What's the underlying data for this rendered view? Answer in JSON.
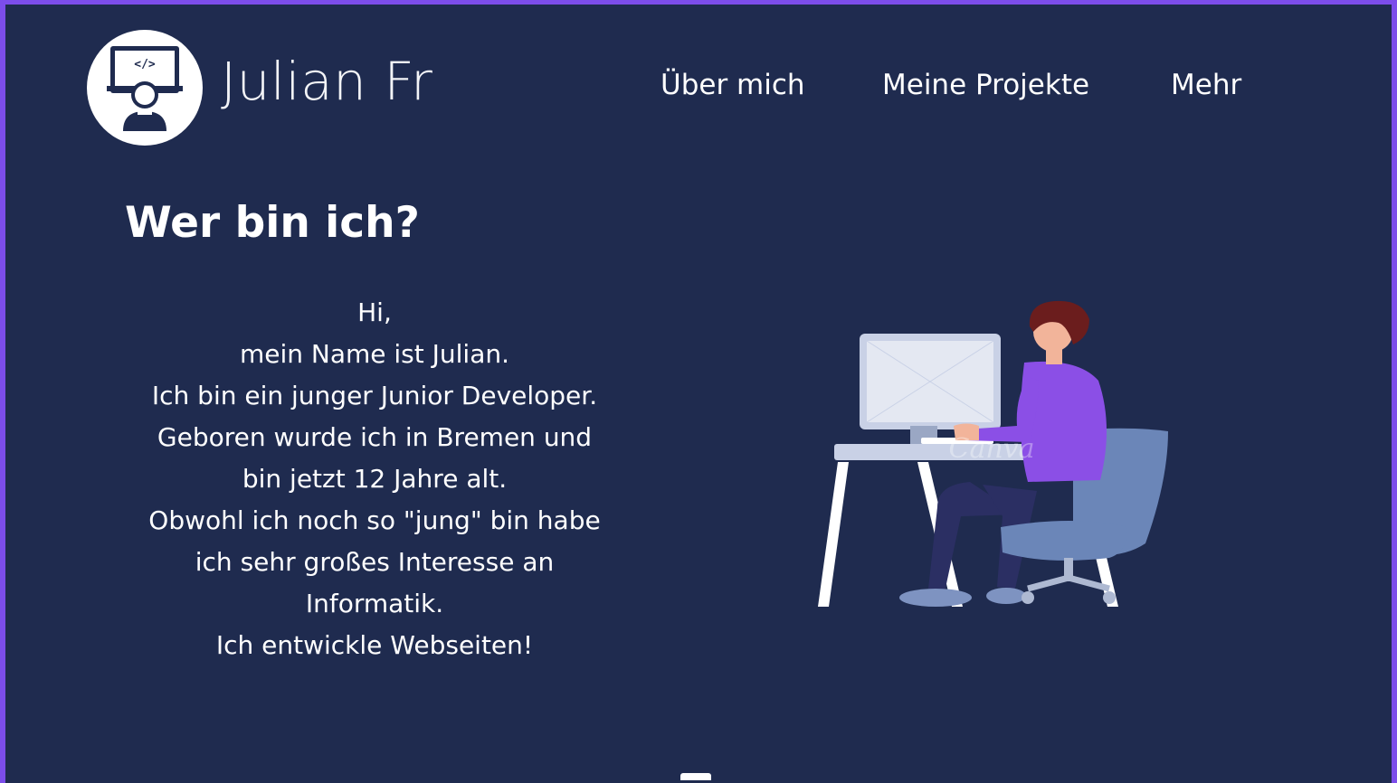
{
  "header": {
    "brand": "Julian Fr",
    "logo_icon": "developer-avatar-icon",
    "logo_code_glyph": "</>"
  },
  "nav": {
    "items": [
      {
        "label": "Über mich"
      },
      {
        "label": "Meine Projekte"
      },
      {
        "label": "Mehr"
      }
    ]
  },
  "main": {
    "heading": "Wer bin ich?",
    "intro_lines": [
      "Hi,",
      "mein Name ist Julian.",
      "Ich bin ein junger Junior Developer.",
      "Geboren wurde ich in Bremen und",
      "bin jetzt 12 Jahre alt.",
      "Obwohl ich noch so \"jung\" bin habe",
      "ich  sehr großes Interesse an",
      "Informatik.",
      "Ich entwickle Webseiten!"
    ],
    "illustration": {
      "icon": "developer-at-desk-illustration",
      "watermark": "Canva"
    }
  },
  "colors": {
    "page_background": "#1f2b4f",
    "border": "#7c4dea",
    "text": "#ffffff",
    "shirt": "#8b4fe6",
    "chair": "#6b86b8",
    "desk": "#c9d1e6"
  }
}
